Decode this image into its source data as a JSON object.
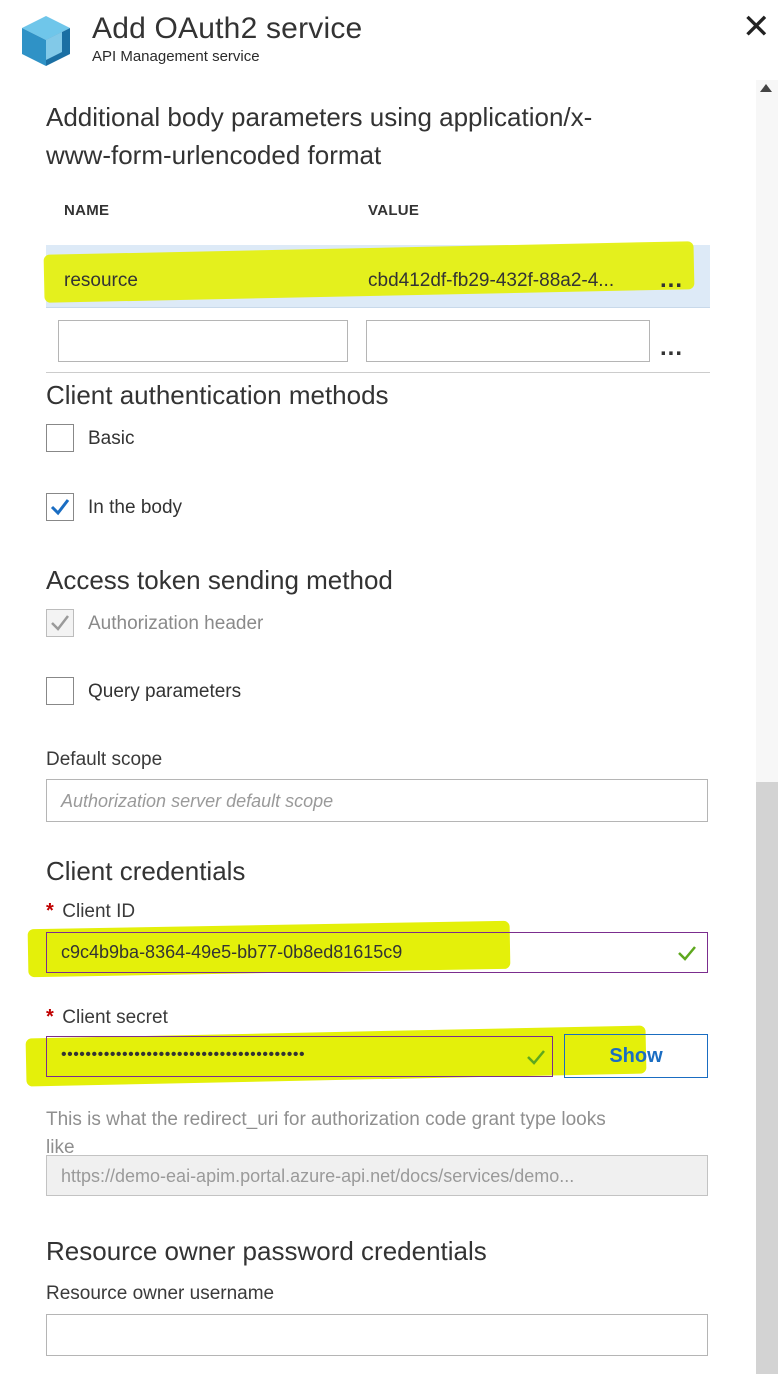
{
  "header": {
    "title": "Add OAuth2 service",
    "subtitle": "API Management service",
    "close_icon": "close-icon",
    "logo_icon": "cube-icon"
  },
  "body_params": {
    "heading": "Additional body parameters using application/x-www-form-urlencoded format",
    "heading_line1": "Additional body parameters using application/x-",
    "heading_line2": "www-form-urlencoded format",
    "columns": [
      "NAME",
      "VALUE"
    ],
    "rows": [
      {
        "name": "resource",
        "value": "cbd412df-fb29-432f-88a2-4...",
        "more": "..."
      }
    ],
    "new_row": {
      "name": "",
      "value": "",
      "more": "..."
    }
  },
  "client_auth": {
    "heading": "Client authentication methods",
    "options": [
      {
        "label": "Basic",
        "checked": false
      },
      {
        "label": "In the body",
        "checked": true
      }
    ]
  },
  "token_method": {
    "heading": "Access token sending method",
    "options": [
      {
        "label": "Authorization header",
        "checked": true,
        "disabled": true
      },
      {
        "label": "Query parameters",
        "checked": false
      }
    ]
  },
  "default_scope": {
    "label": "Default scope",
    "placeholder": "Authorization server default scope",
    "value": ""
  },
  "client_credentials": {
    "heading": "Client credentials",
    "client_id_label": "Client ID",
    "client_id_value": "c9c4b9ba-8364-49e5-bb77-0b8ed81615c9",
    "client_secret_label": "Client secret",
    "client_secret_value": "••••••••••••••••••••••••••••••••••••••••",
    "show_label": "Show",
    "required_mark": "*",
    "valid_icon": "checkmark-icon"
  },
  "redirect": {
    "help_text": "This is what the redirect_uri for authorization code grant type looks like",
    "help_line1": "This is what the redirect_uri for authorization code grant type looks",
    "help_line2": "like",
    "value": "https://demo-eai-apim.portal.azure-api.net/docs/services/demo..."
  },
  "resource_owner": {
    "heading": "Resource owner password credentials",
    "username_label": "Resource owner username",
    "username_value": ""
  },
  "colors": {
    "accent": "#1a6dc2",
    "selected_row": "#ddeaf7",
    "validation_border": "#7b2d8e",
    "valid_check": "#5ea81e",
    "required": "#c00000",
    "highlight": "#e4f00a"
  }
}
